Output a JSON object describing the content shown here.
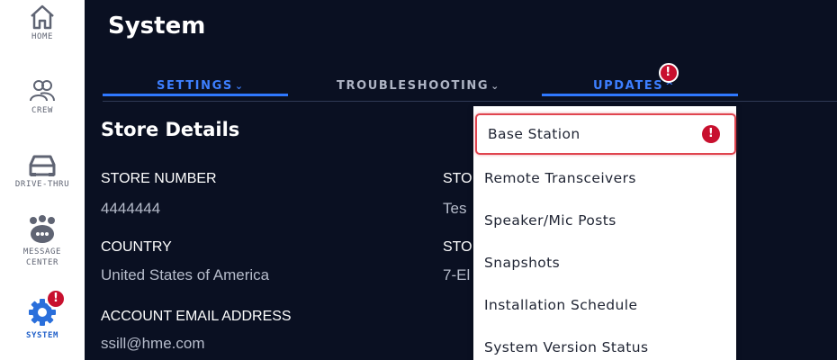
{
  "sidebar": {
    "items": [
      {
        "label": "HOME",
        "icon": "home-icon"
      },
      {
        "label": "CREW",
        "icon": "crew-icon"
      },
      {
        "label": "DRIVE-THRU",
        "icon": "car-icon"
      },
      {
        "label": "MESSAGE CENTER",
        "icon": "message-center-icon"
      },
      {
        "label": "SYSTEM",
        "icon": "gear-icon",
        "badge": "!",
        "active": true
      }
    ]
  },
  "header": {
    "title": "System"
  },
  "tabs": [
    {
      "label": "SETTINGS",
      "chevron": "⌄"
    },
    {
      "label": "TROUBLESHOOTING",
      "chevron": "⌄"
    },
    {
      "label": "UPDATES",
      "chevron": "^",
      "badge": "!"
    }
  ],
  "store": {
    "section_title": "Store Details",
    "fields": [
      {
        "label": "STORE NUMBER",
        "value": "4444444"
      },
      {
        "label": "COUNTRY",
        "value": "United States of America"
      },
      {
        "label": "ACCOUNT EMAIL ADDRESS",
        "value": "ssill@hme.com"
      }
    ],
    "right_fields": [
      {
        "label": "STO",
        "value": "Tes"
      },
      {
        "label": "STO",
        "value": "7-El"
      }
    ]
  },
  "updates_menu": {
    "items": [
      {
        "label": "Base Station",
        "badge": "!"
      },
      {
        "label": "Remote Transceivers"
      },
      {
        "label": "Speaker/Mic Posts"
      },
      {
        "label": "Snapshots"
      },
      {
        "label": "Installation Schedule"
      },
      {
        "label": "System Version Status"
      }
    ]
  },
  "colors": {
    "background": "#0a1022",
    "accent": "#2f78ff",
    "alert": "#c8102e",
    "highlight_border": "#e0454f"
  }
}
